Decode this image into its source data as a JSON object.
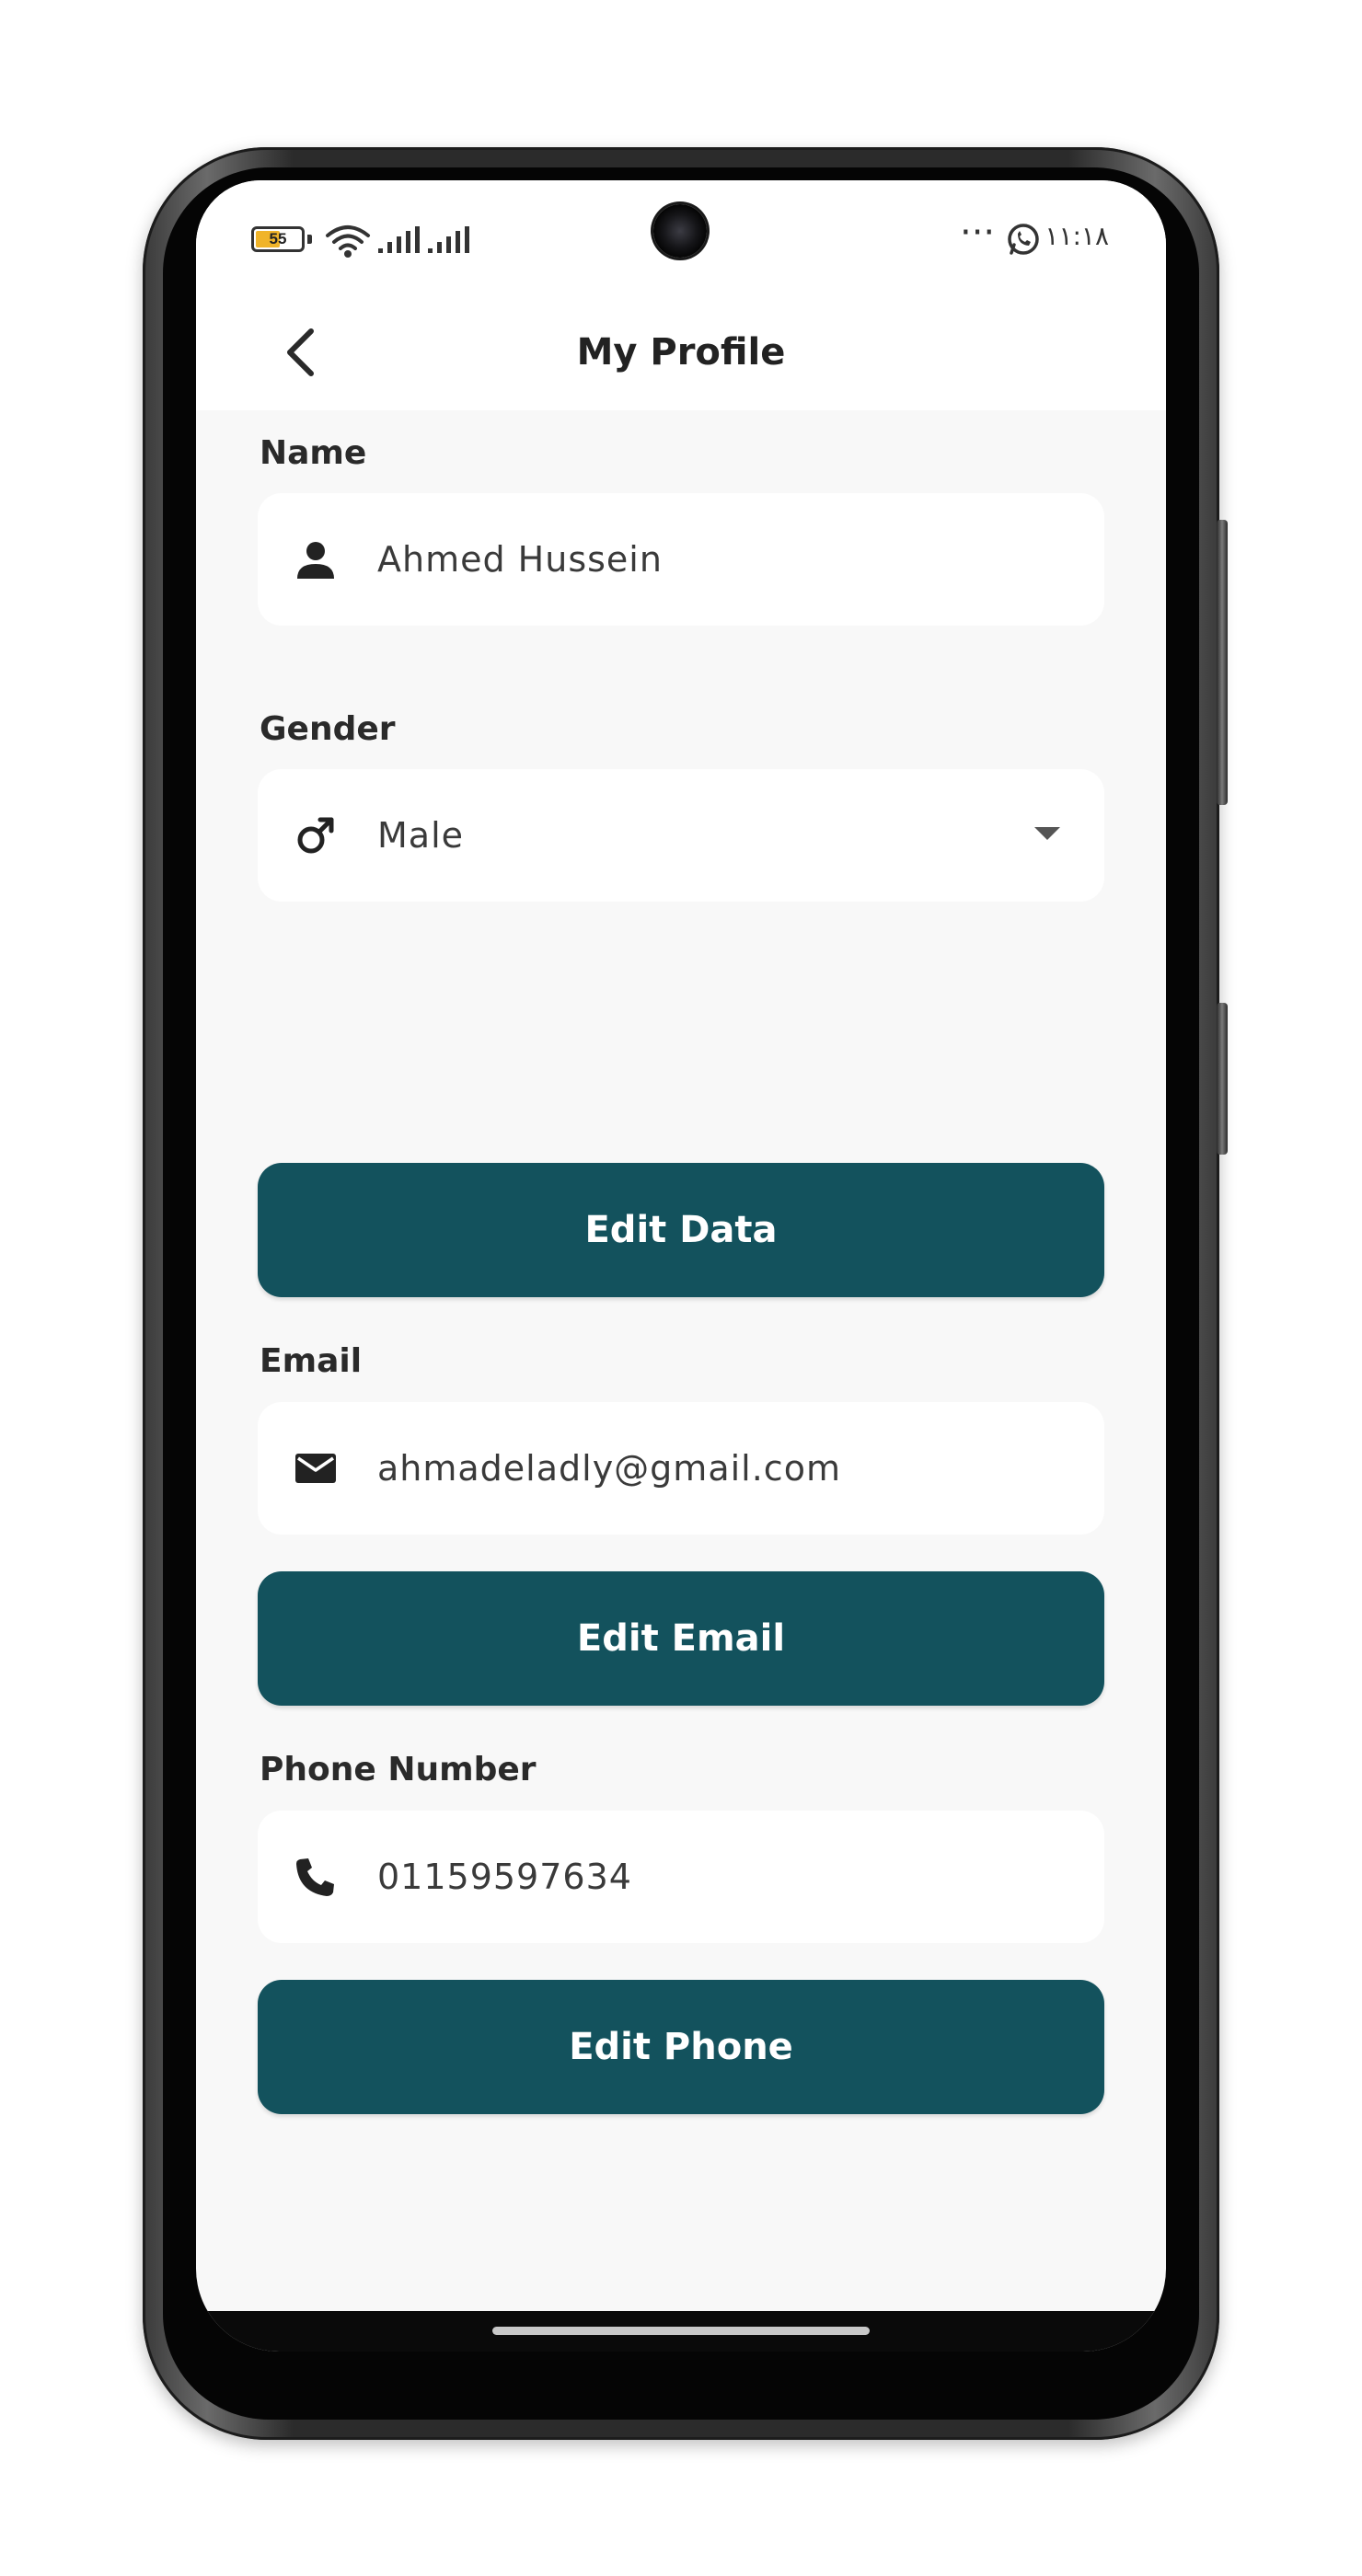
{
  "status_bar": {
    "battery_level": "55",
    "battery_fraction": 0.55,
    "time": "١١:١٨",
    "notification_dots": "···",
    "icons": [
      "battery-icon",
      "wifi-icon",
      "signal-icon",
      "signal-icon",
      "more-dots-icon",
      "whatsapp-icon"
    ]
  },
  "header": {
    "title": "My Profile",
    "back_icon": "chevron-left-icon"
  },
  "name_field": {
    "label": "Name",
    "value": "Ahmed Hussein",
    "icon": "person-icon"
  },
  "gender_field": {
    "label": "Gender",
    "value": "Male",
    "icon": "male-icon",
    "dropdown_icon": "caret-down-icon"
  },
  "edit_data_button": {
    "label": "Edit Data"
  },
  "email_field": {
    "label": "Email",
    "value": "ahmadeladly@gmail.com",
    "icon": "mail-icon"
  },
  "edit_email_button": {
    "label": "Edit Email"
  },
  "phone_field": {
    "label": "Phone Number",
    "value": "01159597634",
    "icon": "phone-icon"
  },
  "edit_phone_button": {
    "label": "Edit Phone"
  },
  "colors": {
    "primary_button": "#13525d",
    "screen_background": "#f8f8f8",
    "field_background": "#ffffff",
    "battery_accent": "#f0b429"
  }
}
